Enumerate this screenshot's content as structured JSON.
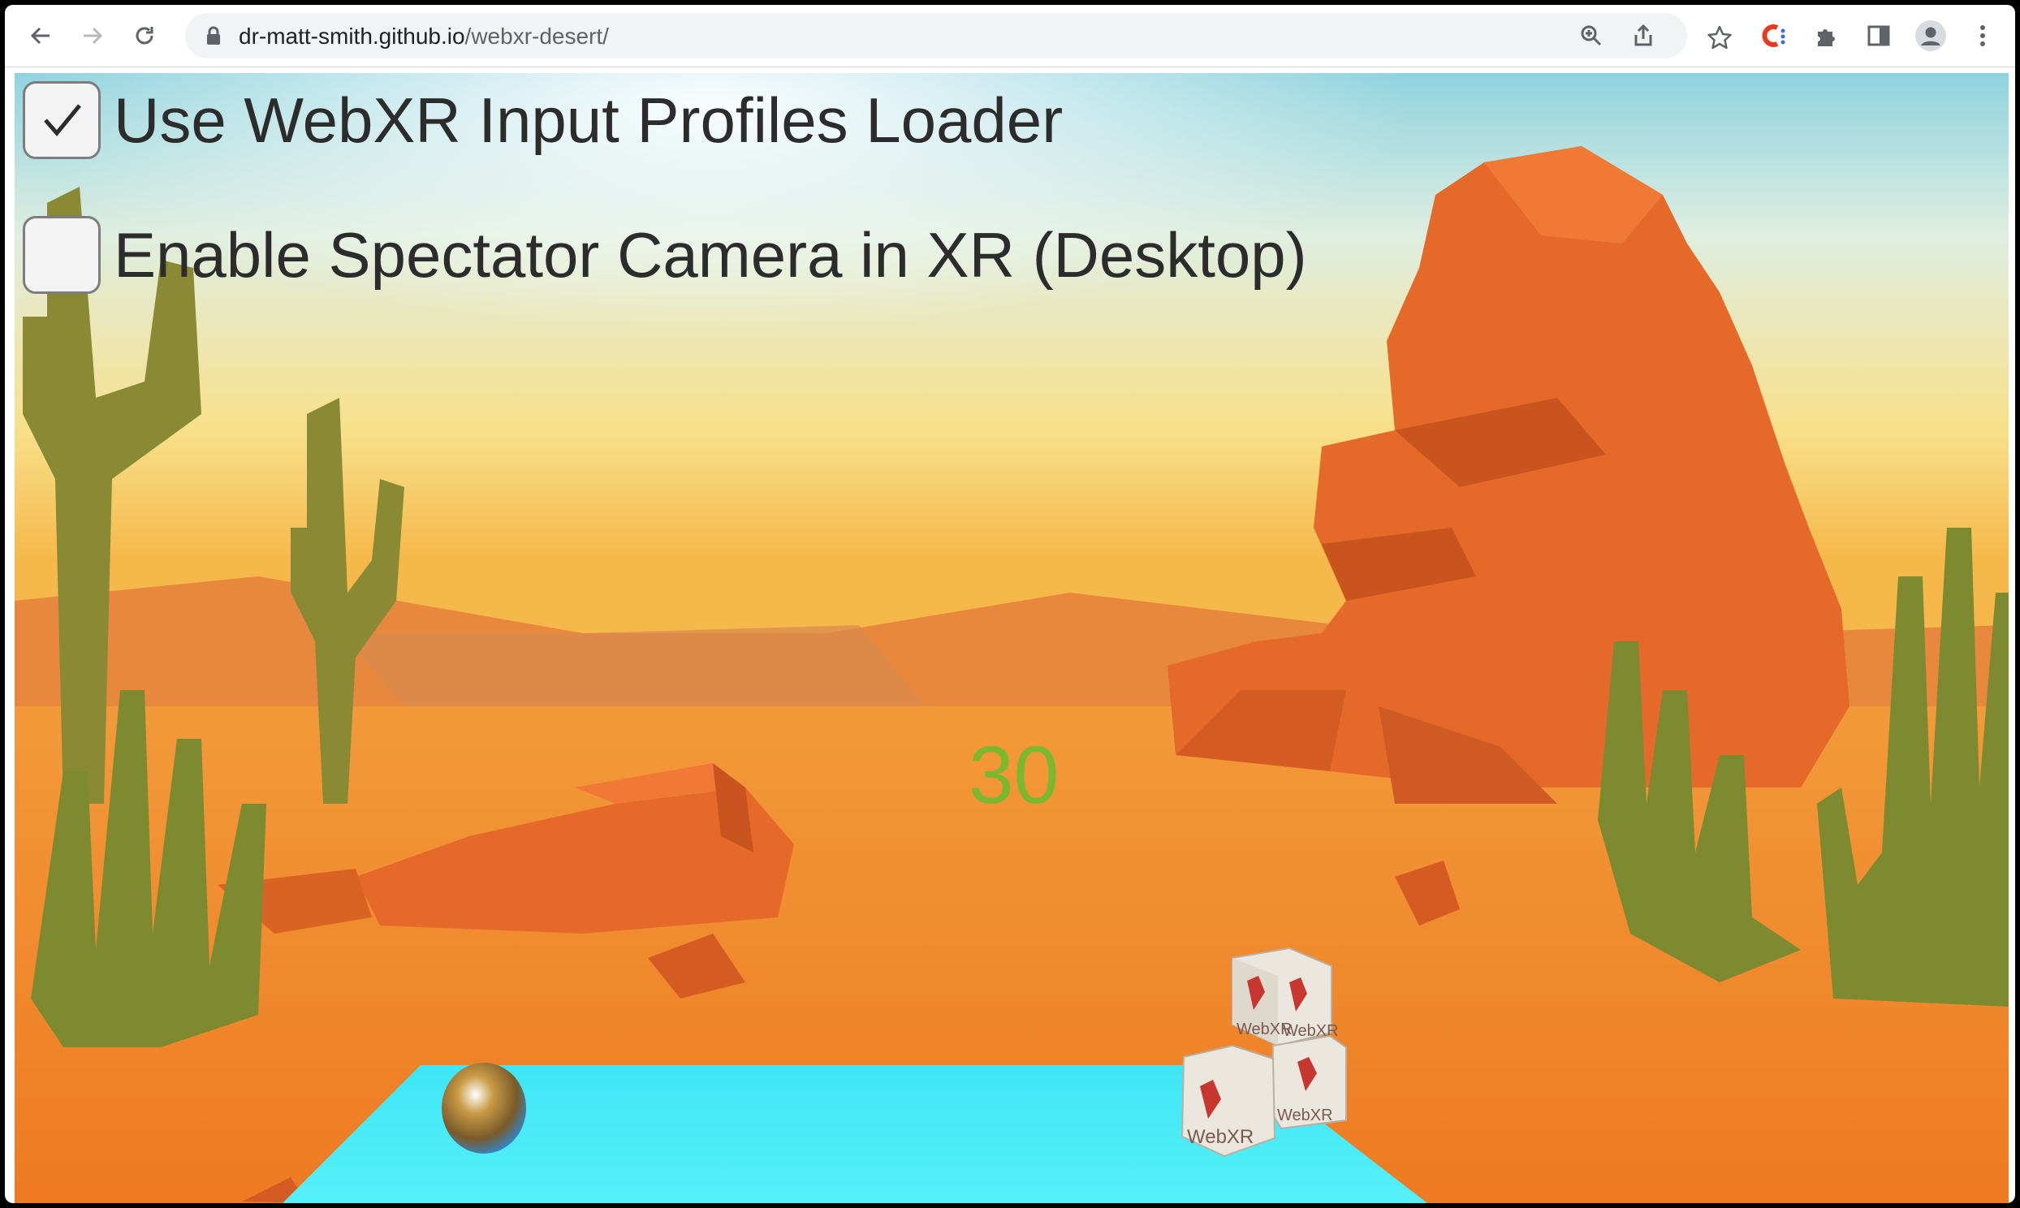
{
  "browser": {
    "url_host": "dr-matt-smith.github.io",
    "url_path": "/webxr-desert/",
    "icons": [
      "back-icon",
      "forward-icon",
      "reload-icon",
      "lock-icon",
      "zoom-icon",
      "share-icon",
      "star-icon",
      "extension-c-icon",
      "puzzle-icon",
      "side-panel-icon",
      "profile-icon",
      "menu-icon"
    ]
  },
  "options": [
    {
      "label": "Use WebXR Input Profiles Loader",
      "checked": true
    },
    {
      "label": "Enable Spectator Camera in XR (Desktop)",
      "checked": false
    }
  ],
  "scene": {
    "counter": "30",
    "cube_label": "WebXR",
    "colors": {
      "sky_top": "#8fd3e0",
      "sand": "#f08a30",
      "rock": "#e56a2a",
      "cactus": "#8a8a35",
      "floor": "#3fe6f5",
      "counter": "#7ab82e"
    }
  }
}
